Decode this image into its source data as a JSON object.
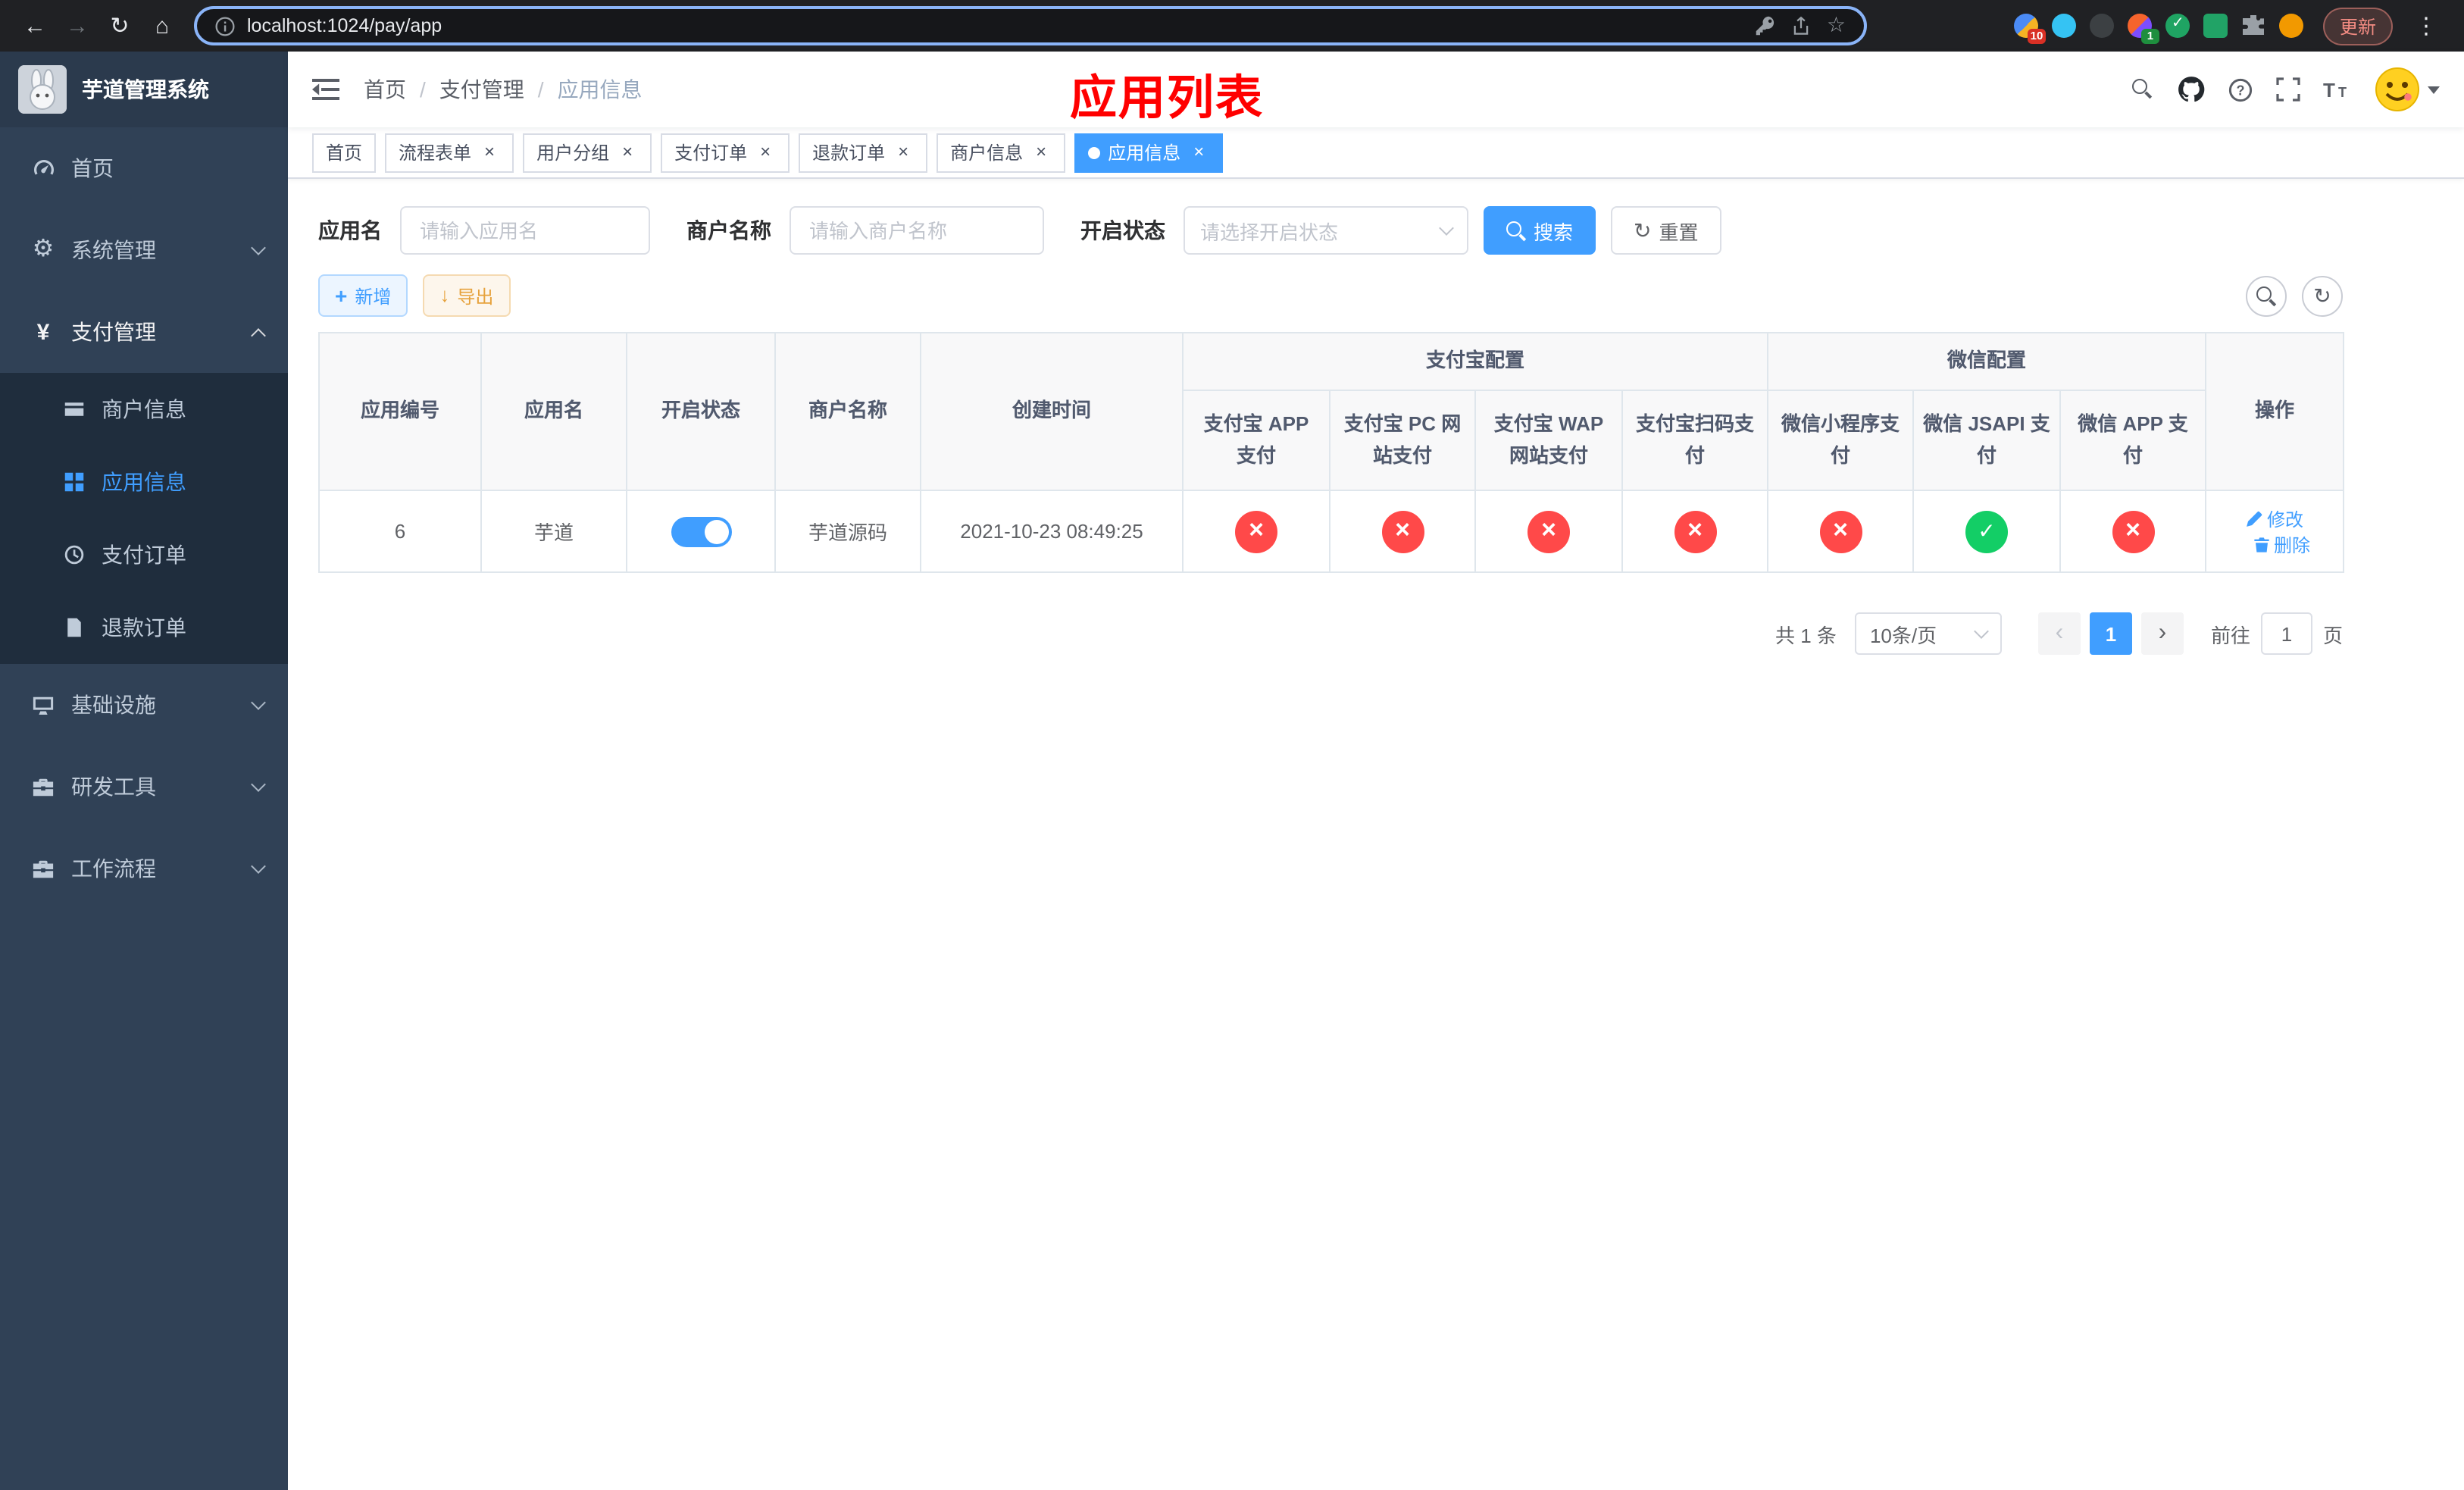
{
  "browser": {
    "url": "localhost:1024/pay/app",
    "update_label": "更新",
    "ext_badge": "10",
    "wallet_badge": "1"
  },
  "sidebar": {
    "title": "芋道管理系统",
    "menu": [
      {
        "label": "首页"
      },
      {
        "label": "系统管理"
      },
      {
        "label": "支付管理",
        "expanded": true
      },
      {
        "label": "基础设施"
      },
      {
        "label": "研发工具"
      },
      {
        "label": "工作流程"
      }
    ],
    "submenu": [
      {
        "label": "商户信息",
        "active": false
      },
      {
        "label": "应用信息",
        "active": true
      },
      {
        "label": "支付订单",
        "active": false
      },
      {
        "label": "退款订单",
        "active": false
      }
    ]
  },
  "header": {
    "breadcrumb": [
      "首页",
      "支付管理",
      "应用信息"
    ],
    "title": "应用列表"
  },
  "tabs": [
    {
      "label": "首页",
      "closable": false,
      "active": false
    },
    {
      "label": "流程表单",
      "closable": true,
      "active": false
    },
    {
      "label": "用户分组",
      "closable": true,
      "active": false
    },
    {
      "label": "支付订单",
      "closable": true,
      "active": false
    },
    {
      "label": "退款订单",
      "closable": true,
      "active": false
    },
    {
      "label": "商户信息",
      "closable": true,
      "active": false
    },
    {
      "label": "应用信息",
      "closable": true,
      "active": true
    }
  ],
  "filters": {
    "app_name": {
      "label": "应用名",
      "placeholder": "请输入应用名",
      "value": ""
    },
    "merchant_name": {
      "label": "商户名称",
      "placeholder": "请输入商户名称",
      "value": ""
    },
    "status": {
      "label": "开启状态",
      "placeholder": "请选择开启状态",
      "value": ""
    },
    "search_label": "搜索",
    "reset_label": "重置"
  },
  "toolbar": {
    "add_label": "新增",
    "export_label": "导出"
  },
  "table": {
    "headers": {
      "app_id": "应用编号",
      "app_name": "应用名",
      "status": "开启状态",
      "merchant_name": "商户名称",
      "create_time": "创建时间",
      "alipay_group": "支付宝配置",
      "alipay_app": "支付宝 APP 支付",
      "alipay_pc": "支付宝 PC 网站支付",
      "alipay_wap": "支付宝 WAP 网站支付",
      "alipay_qr": "支付宝扫码支付",
      "wx_group": "微信配置",
      "wx_lite": "微信小程序支付",
      "wx_jsapi": "微信 JSAPI 支付",
      "wx_app": "微信 APP 支付",
      "actions": "操作"
    },
    "rows": [
      {
        "app_id": "6",
        "app_name": "芋道",
        "status_on": true,
        "merchant_name": "芋道源码",
        "create_time": "2021-10-23 08:49:25",
        "configs": {
          "alipay_app": false,
          "alipay_pc": false,
          "alipay_wap": false,
          "alipay_qr": false,
          "wx_lite": false,
          "wx_jsapi": true,
          "wx_app": false
        },
        "edit_label": "修改",
        "delete_label": "删除"
      }
    ]
  },
  "pagination": {
    "total_label": "共 1 条",
    "page_size": "10条/页",
    "current_page": "1",
    "goto_label": "前往",
    "goto_value": "1",
    "page_unit": "页"
  },
  "icons": {
    "close": "×",
    "check": "✓",
    "cross": "×",
    "back": "←",
    "forward": "→",
    "reload": "↻",
    "home": "⌂",
    "star": "☆",
    "more": "⋮",
    "prev": "‹",
    "next": "›",
    "plus": "+",
    "download": "↓",
    "gear": "⚙",
    "yen": "¥"
  },
  "colors": {
    "accent": "#409eff",
    "sidebar_bg": "#304156",
    "submenu_bg": "#1f2d3d",
    "danger": "#ff4949",
    "success": "#13ce66",
    "warning": "#e6a23c",
    "title_red": "#ff0000"
  }
}
